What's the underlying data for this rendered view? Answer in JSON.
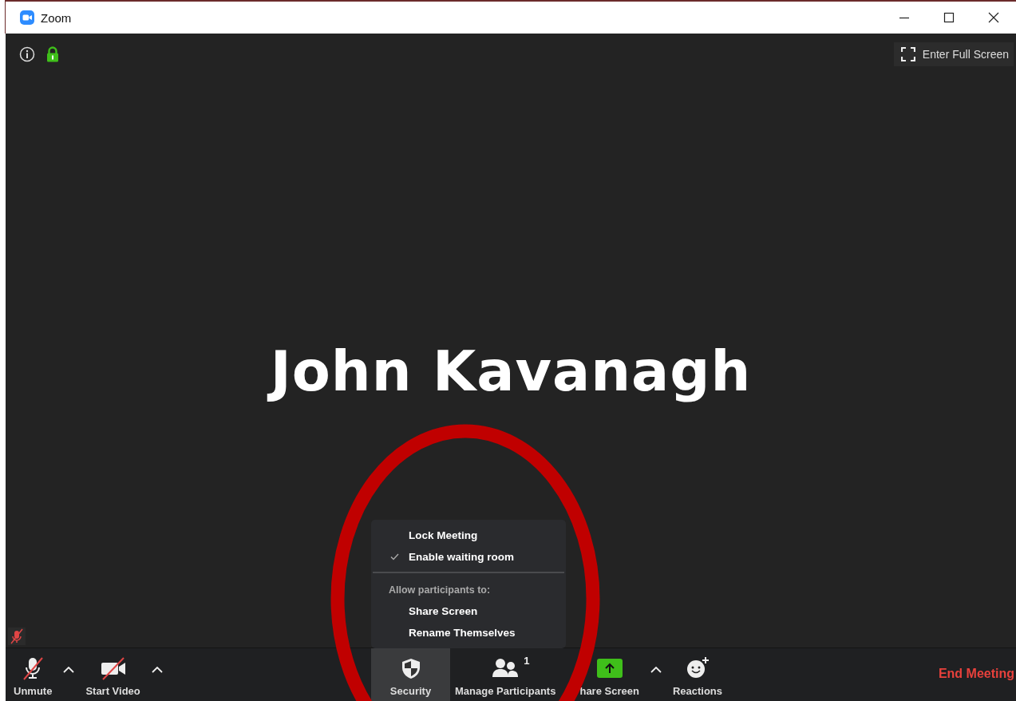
{
  "window": {
    "title": "Zoom"
  },
  "top_bar": {
    "fullscreen_button": "Enter Full Screen",
    "encrypted": true
  },
  "participant": {
    "name": "John Kavanagh",
    "muted": true
  },
  "security_menu": {
    "items": [
      {
        "kind": "option",
        "label": "Lock Meeting",
        "checked": false
      },
      {
        "kind": "option",
        "label": "Enable waiting room",
        "checked": true
      },
      {
        "kind": "divider"
      },
      {
        "kind": "header",
        "label": "Allow participants to:"
      },
      {
        "kind": "option",
        "label": "Share Screen",
        "checked": false
      },
      {
        "kind": "option",
        "label": "Rename Themselves",
        "checked": false
      }
    ]
  },
  "toolbar": {
    "left": [
      {
        "kind": "mic",
        "label": "Unmute",
        "off": true
      },
      {
        "kind": "caret"
      },
      {
        "kind": "video",
        "label": "Start Video",
        "off": true
      },
      {
        "kind": "caret"
      }
    ],
    "center": [
      {
        "kind": "security",
        "label": "Security",
        "selected": true
      },
      {
        "kind": "participants",
        "label": "Manage Participants",
        "count": "1",
        "selected": false
      },
      {
        "kind": "share",
        "label": "hare Screen",
        "selected": false
      },
      {
        "kind": "caret"
      },
      {
        "kind": "reactions",
        "label": "Reactions",
        "selected": false
      }
    ],
    "end_button": "End Meeting"
  },
  "annotation": {
    "kind": "ellipse",
    "color": "#c00000"
  }
}
